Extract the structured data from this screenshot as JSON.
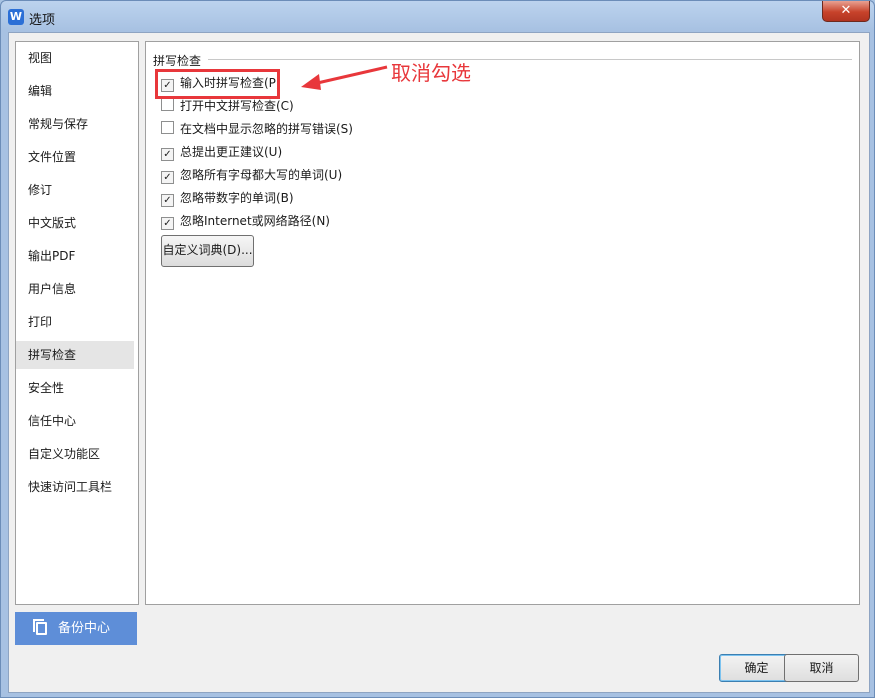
{
  "window": {
    "title": "选项",
    "app_icon_glyph": "W",
    "close_glyph": "✕"
  },
  "sidebar": {
    "items": [
      {
        "label": "视图"
      },
      {
        "label": "编辑"
      },
      {
        "label": "常规与保存"
      },
      {
        "label": "文件位置"
      },
      {
        "label": "修订"
      },
      {
        "label": "中文版式"
      },
      {
        "label": "输出PDF"
      },
      {
        "label": "用户信息"
      },
      {
        "label": "打印"
      },
      {
        "label": "拼写检查",
        "selected": true
      },
      {
        "label": "安全性"
      },
      {
        "label": "信任中心"
      },
      {
        "label": "自定义功能区"
      },
      {
        "label": "快速访问工具栏"
      }
    ],
    "backup_button": "备份中心"
  },
  "spellcheck": {
    "group_title": "拼写检查",
    "options": [
      {
        "label": "输入时拼写检查(P)",
        "checked": true
      },
      {
        "label": "打开中文拼写检查(C)",
        "checked": false
      },
      {
        "label": "在文档中显示忽略的拼写错误(S)",
        "checked": false
      },
      {
        "label": "总提出更正建议(U)",
        "checked": true
      },
      {
        "label": "忽略所有字母都大写的单词(U)",
        "checked": true
      },
      {
        "label": "忽略带数字的单词(B)",
        "checked": true
      },
      {
        "label": "忽略Internet或网络路径(N)",
        "checked": true
      }
    ],
    "custom_dict_button": "自定义词典(D)..."
  },
  "annotation": {
    "text": "取消勾选",
    "color": "#e8373b"
  },
  "footer": {
    "ok_label": "确定",
    "cancel_label": "取消"
  },
  "colors": {
    "accent_blue": "#5e8ed8",
    "selection_gray": "#e5e5e5"
  }
}
